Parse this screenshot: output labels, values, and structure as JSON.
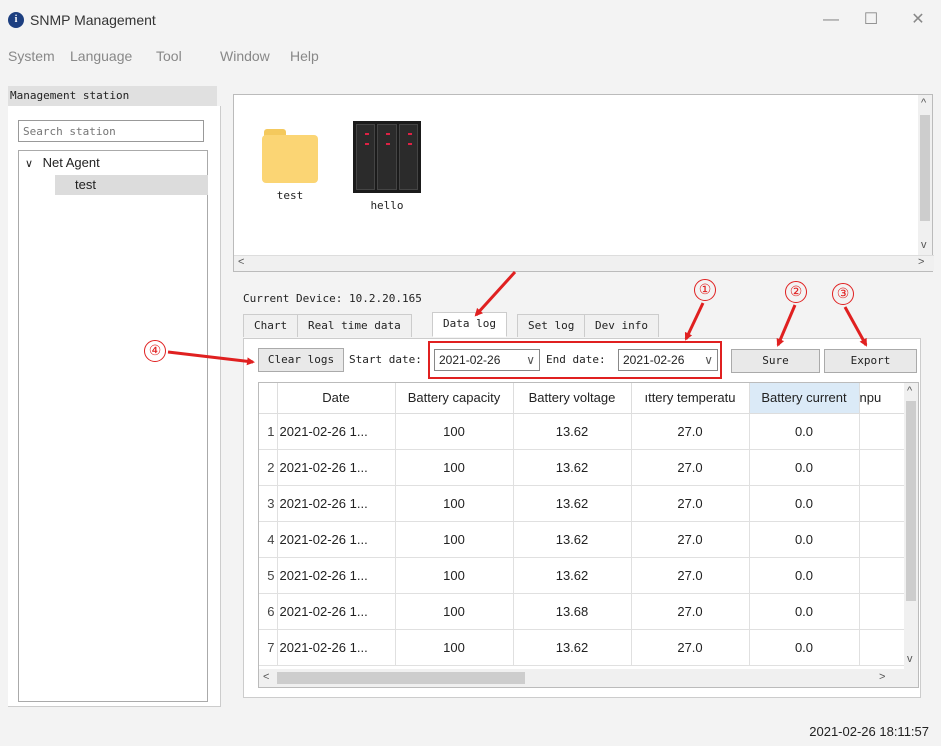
{
  "window": {
    "title": "SNMP Management",
    "icon_glyph": "i",
    "minimize": "—",
    "maximize": "☐",
    "close": "✕"
  },
  "menu": [
    "System",
    "Language",
    "Tool",
    "Window",
    "Help"
  ],
  "sidebar": {
    "header": "Management station",
    "search_placeholder": "Search station",
    "tree": {
      "root": "Net Agent",
      "root_chevron": "∨",
      "children": [
        "test"
      ]
    }
  },
  "devices": [
    {
      "label": "test",
      "icon": "folder-icon"
    },
    {
      "label": "hello",
      "icon": "server-icon"
    }
  ],
  "current_device": {
    "label": "Current Device:",
    "value": "10.2.20.165"
  },
  "tabs": [
    {
      "label": "Chart",
      "active": false
    },
    {
      "label": "Real time data",
      "active": false
    },
    {
      "label": "Data log",
      "active": true
    },
    {
      "label": "Set log",
      "active": false
    },
    {
      "label": "Dev info",
      "active": false
    }
  ],
  "toolbar": {
    "clear_logs": "Clear logs",
    "start_label": "Start date:",
    "start_value": "2021-02-26",
    "end_label": "End date:",
    "end_value": "2021-02-26",
    "sure": "Sure",
    "export": "Export"
  },
  "table": {
    "columns": [
      "Date",
      "Battery capacity",
      "Battery voltage",
      "ıttery temperatu",
      "Battery current",
      "npu"
    ],
    "highlighted_column": "Battery current",
    "rows": [
      {
        "n": "1",
        "date": "2021-02-26 1...",
        "capacity": "100",
        "voltage": "13.62",
        "temp": "27.0",
        "current": "0.0"
      },
      {
        "n": "2",
        "date": "2021-02-26 1...",
        "capacity": "100",
        "voltage": "13.62",
        "temp": "27.0",
        "current": "0.0"
      },
      {
        "n": "3",
        "date": "2021-02-26 1...",
        "capacity": "100",
        "voltage": "13.62",
        "temp": "27.0",
        "current": "0.0"
      },
      {
        "n": "4",
        "date": "2021-02-26 1...",
        "capacity": "100",
        "voltage": "13.62",
        "temp": "27.0",
        "current": "0.0"
      },
      {
        "n": "5",
        "date": "2021-02-26 1...",
        "capacity": "100",
        "voltage": "13.62",
        "temp": "27.0",
        "current": "0.0"
      },
      {
        "n": "6",
        "date": "2021-02-26 1...",
        "capacity": "100",
        "voltage": "13.68",
        "temp": "27.0",
        "current": "0.0"
      },
      {
        "n": "7",
        "date": "2021-02-26 1...",
        "capacity": "100",
        "voltage": "13.62",
        "temp": "27.0",
        "current": "0.0"
      }
    ]
  },
  "annotations": {
    "markers": [
      "①",
      "②",
      "③",
      "④"
    ],
    "color": "#e02020"
  },
  "status": {
    "datetime": "2021-02-26 18:11:57"
  },
  "scroll_glyphs": {
    "up": "^",
    "down": "v",
    "left": "<",
    "right": ">"
  }
}
